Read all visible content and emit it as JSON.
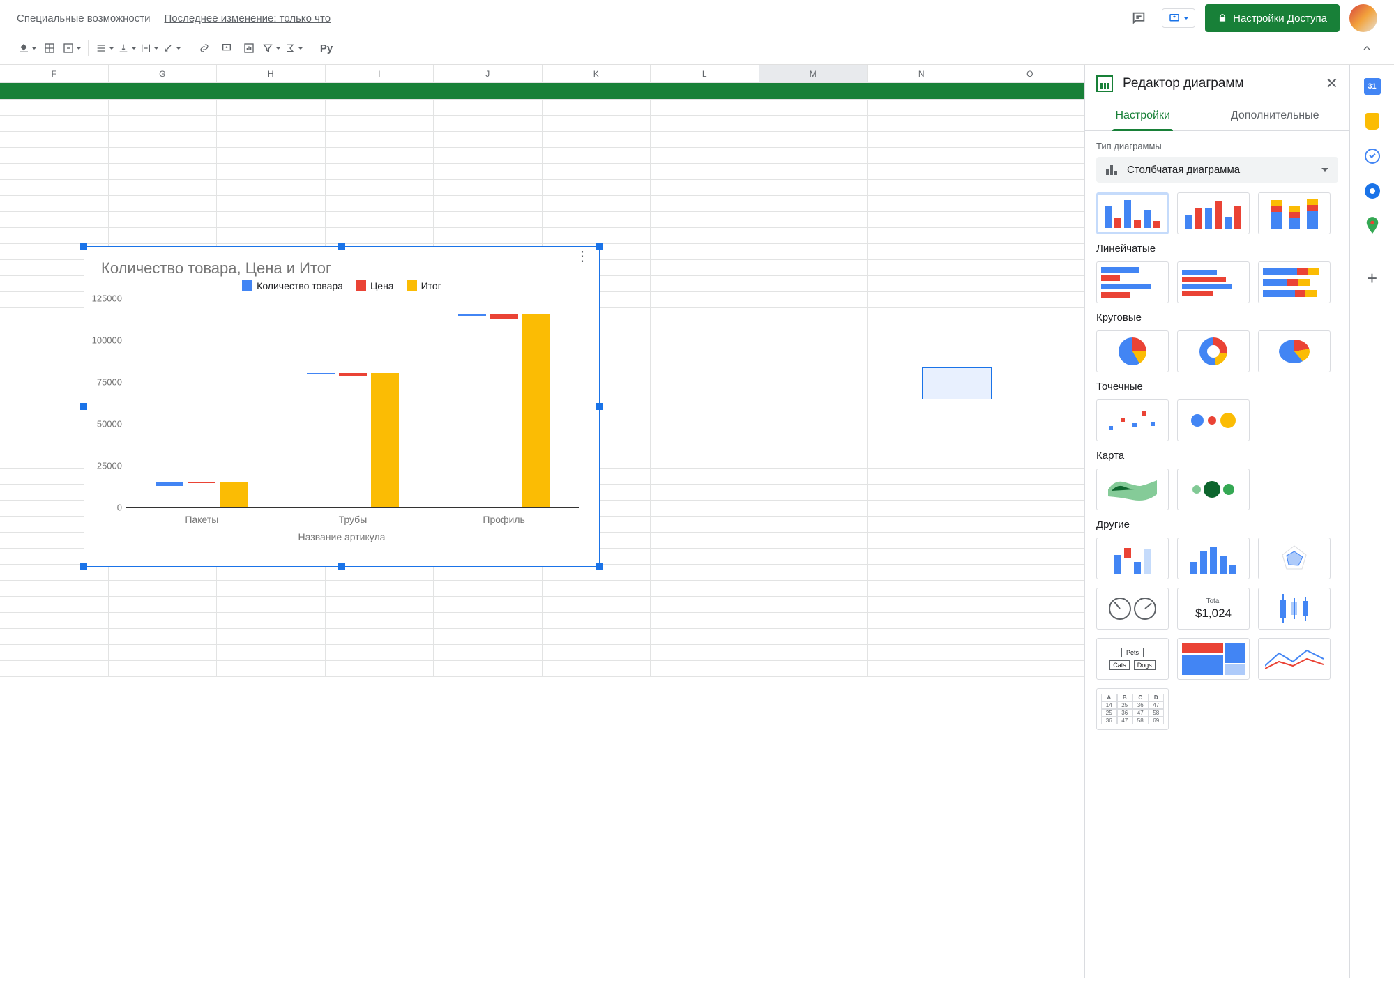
{
  "top": {
    "accessibility": "Специальные возможности",
    "last_edit": "Последнее изменение: только что",
    "share": "Настройки Доступа"
  },
  "toolbar": {
    "functions_label": "Ру"
  },
  "columns": [
    "F",
    "G",
    "H",
    "I",
    "J",
    "K",
    "L",
    "M",
    "N",
    "O"
  ],
  "selected_column": "M",
  "chart_data": {
    "type": "bar",
    "title": "Количество товара, Цена и Итог",
    "xlabel": "Название артикула",
    "ylabel": "",
    "ylim": [
      0,
      125000
    ],
    "yticks": [
      0,
      25000,
      50000,
      75000,
      100000,
      125000
    ],
    "categories": [
      "Пакеты",
      "Трубы",
      "Профиль"
    ],
    "series": [
      {
        "name": "Количество товара",
        "color": "#4285f4",
        "values": [
          2500,
          500,
          500
        ]
      },
      {
        "name": "Цена",
        "color": "#ea4335",
        "values": [
          500,
          2000,
          2500
        ]
      },
      {
        "name": "Итог",
        "color": "#fbbc04",
        "values": [
          15000,
          80000,
          115000
        ]
      }
    ]
  },
  "panel": {
    "title": "Редактор диаграмм",
    "tabs": {
      "setup": "Настройки",
      "customize": "Дополнительные"
    },
    "typeLabel": "Тип диаграммы",
    "typeValue": "Столбчатая диаграмма",
    "sections": {
      "bar_h": "Линейчатые",
      "pie": "Круговые",
      "scatter": "Точечные",
      "map": "Карта",
      "other": "Другие"
    },
    "scorecard": {
      "top": "Total",
      "value": "$1,024"
    },
    "tablethumb": {
      "head": [
        "A",
        "B",
        "C",
        "D"
      ],
      "rows": [
        [
          "14",
          "25",
          "36",
          "47"
        ],
        [
          "25",
          "36",
          "47",
          "58"
        ],
        [
          "36",
          "47",
          "58",
          "69"
        ]
      ]
    },
    "orgthumb": {
      "root": "Pets",
      "children": [
        "Cats",
        "Dogs"
      ]
    }
  }
}
